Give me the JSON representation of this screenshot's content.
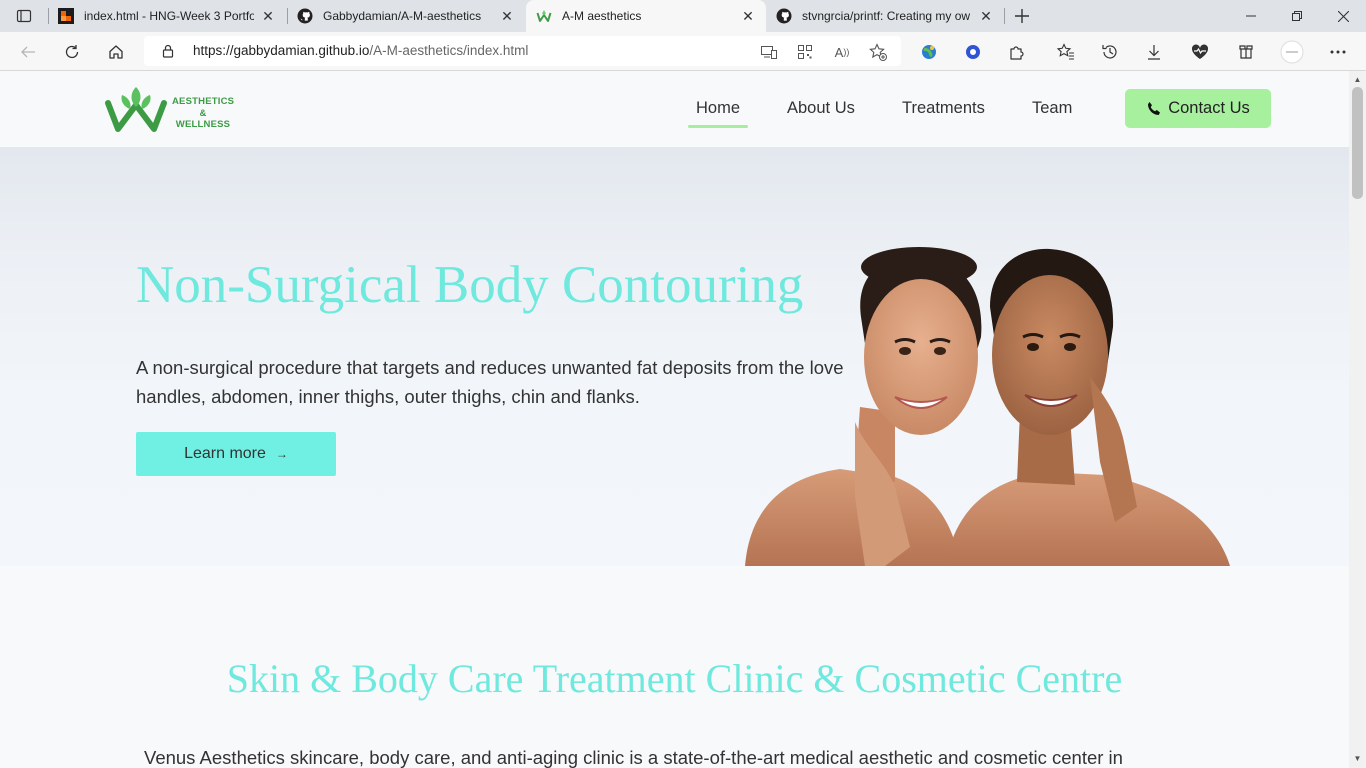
{
  "browser": {
    "tabs": [
      {
        "title": "index.html - HNG-Week 3 Portfo",
        "icon": "replit-icon",
        "active": false
      },
      {
        "title": "Gabbydamian/A-M-aesthetics",
        "icon": "github-icon",
        "active": false
      },
      {
        "title": "A-M aesthetics",
        "icon": "site-logo-icon",
        "active": true
      },
      {
        "title": "stvngrcia/printf: Creating my ow",
        "icon": "github-icon",
        "active": false
      }
    ],
    "address": {
      "protocol_host": "https://gabbydamian.github.io",
      "path": "/A-M-aesthetics/index.html"
    }
  },
  "site": {
    "logo_lines": [
      "AESTHETICS",
      "&",
      "WELLNESS"
    ],
    "nav": {
      "home": "Home",
      "about": "About Us",
      "treatments": "Treatments",
      "team": "Team",
      "contact": "Contact Us"
    },
    "hero": {
      "title": "Non-Surgical Body Contouring",
      "description": "A non-surgical procedure that targets and reduces unwanted fat deposits from the love handles, abdomen, inner thighs, outer thighs, chin and flanks.",
      "cta": "Learn more"
    },
    "section": {
      "title": "Skin & Body Care Treatment Clinic & Cosmetic Centre",
      "description": "Venus Aesthetics skincare, body care, and anti-aging clinic is a state-of-the-art medical aesthetic and cosmetic center in"
    }
  },
  "colors": {
    "accent_teal": "#6fe8dd",
    "accent_green": "#a7f09d",
    "logo_green": "#3d9b45"
  }
}
